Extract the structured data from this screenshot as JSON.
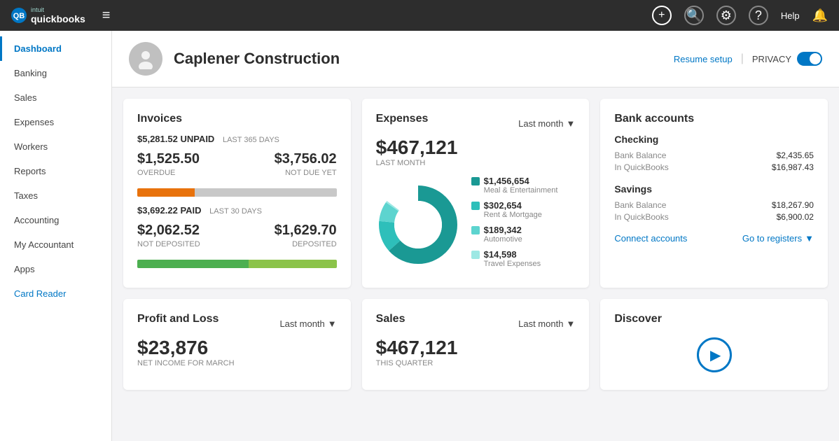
{
  "topnav": {
    "brand_intuit": "intuit",
    "brand_qb": "quickbooks",
    "menu_icon": "≡"
  },
  "sidebar": {
    "items": [
      {
        "label": "Dashboard",
        "active": true
      },
      {
        "label": "Banking"
      },
      {
        "label": "Sales"
      },
      {
        "label": "Expenses"
      },
      {
        "label": "Workers"
      },
      {
        "label": "Reports"
      },
      {
        "label": "Taxes"
      },
      {
        "label": "Accounting"
      },
      {
        "label": "My Accountant"
      },
      {
        "label": "Apps"
      },
      {
        "label": "Card Reader",
        "special": true
      }
    ]
  },
  "header": {
    "company_name": "Caplener Construction",
    "resume_setup": "Resume setup",
    "privacy_label": "PRIVACY"
  },
  "invoices": {
    "title": "Invoices",
    "unpaid_amount": "$5,281.52 UNPAID",
    "unpaid_period": "LAST 365 DAYS",
    "overdue_amount": "$1,525.50",
    "overdue_label": "OVERDUE",
    "not_due_amount": "$3,756.02",
    "not_due_label": "NOT DUE YET",
    "paid_amount": "$3,692.22 PAID",
    "paid_period": "LAST 30 DAYS",
    "not_deposited_amount": "$2,062.52",
    "not_deposited_label": "NOT DEPOSITED",
    "deposited_amount": "$1,629.70",
    "deposited_label": "DEPOSITED"
  },
  "expenses": {
    "title": "Expenses",
    "period": "Last month",
    "amount": "$467,121",
    "sublabel": "LAST MONTH",
    "legend": [
      {
        "color": "#1a9994",
        "amount": "$1,456,654",
        "label": "Meal & Entertainment"
      },
      {
        "color": "#2ebfba",
        "amount": "$302,654",
        "label": "Rent & Mortgage"
      },
      {
        "color": "#5dd4cf",
        "amount": "$189,342",
        "label": "Automotive"
      },
      {
        "color": "#9de8e4",
        "amount": "$14,598",
        "label": "Travel Expenses"
      }
    ],
    "donut": {
      "segments": [
        {
          "value": 1456654,
          "color": "#1a9994"
        },
        {
          "value": 302654,
          "color": "#2ebfba"
        },
        {
          "value": 189342,
          "color": "#5dd4cf"
        },
        {
          "value": 14598,
          "color": "#9de8e4"
        }
      ]
    }
  },
  "bank_accounts": {
    "title": "Bank accounts",
    "checking": {
      "label": "Checking",
      "bank_balance_label": "Bank Balance",
      "bank_balance_value": "$2,435.65",
      "qb_label": "In QuickBooks",
      "qb_value": "$16,987.43"
    },
    "savings": {
      "label": "Savings",
      "bank_balance_label": "Bank Balance",
      "bank_balance_value": "$18,267.90",
      "qb_label": "In QuickBooks",
      "qb_value": "$6,900.02"
    },
    "connect_label": "Connect accounts",
    "registers_label": "Go to registers"
  },
  "profit_loss": {
    "title": "Profit and Loss",
    "period": "Last month",
    "amount": "$23,876",
    "sublabel": "NET INCOME FOR MARCH"
  },
  "sales": {
    "title": "Sales",
    "period": "Last month",
    "amount": "$467,121",
    "sublabel": "THIS QUARTER"
  },
  "discover": {
    "title": "Discover"
  }
}
